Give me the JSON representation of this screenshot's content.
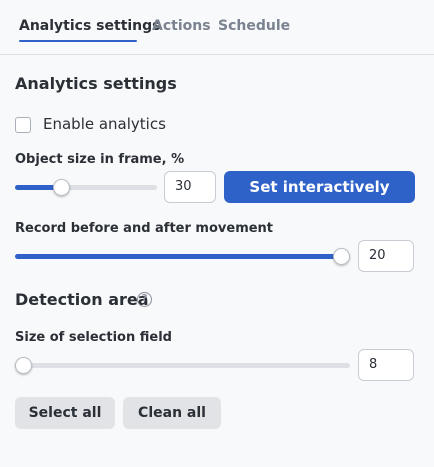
{
  "tabs": [
    {
      "label": "Analytics settings",
      "active": true
    },
    {
      "label": "Actions",
      "active": false
    },
    {
      "label": "Schedule",
      "active": false
    }
  ],
  "analytics": {
    "title": "Analytics settings",
    "enable_label": "Enable analytics",
    "enable_checked": false
  },
  "object_size": {
    "label": "Object size in frame, %",
    "value": "30",
    "slider_fraction": 0.3,
    "set_button": "Set interactively"
  },
  "record": {
    "label": "Record before and after movement",
    "value": "20",
    "slider_fraction": 1.0
  },
  "detection": {
    "title": "Detection area",
    "help_icon": "?",
    "field_label": "Size of selection field",
    "value": "8",
    "slider_fraction": 0.0,
    "select_all": "Select all",
    "clean_all": "Clean all"
  },
  "colors": {
    "accent": "#2f62c8",
    "track": "#dde0e5",
    "background": "#f8f9fa"
  }
}
